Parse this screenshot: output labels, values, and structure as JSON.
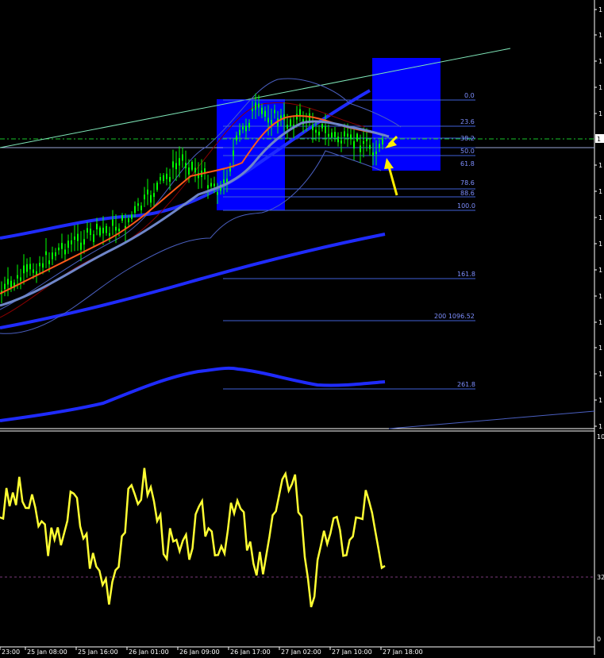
{
  "colors": {
    "background": "#000000",
    "candle": "#00ff00",
    "zone": "#0000ff",
    "ema_fast": "#ff5a1a",
    "ema_slow": "#6f86c9",
    "ma_thick": "#1f2bff",
    "bollinger": "#4a5fc0",
    "bollinger_red": "#8b0000",
    "channel": "#7fe6b8",
    "fib": "#3f5fd6",
    "fib_text": "#7e8fff",
    "dashed_level": "#19c42a",
    "oscillator": "#ffff33",
    "arrow": "#ffee00",
    "grid_text": "#ffffff"
  },
  "fibonacci": {
    "levels": [
      {
        "label": "0.0"
      },
      {
        "label": "23.6"
      },
      {
        "label": "38.2"
      },
      {
        "label": "50.0"
      },
      {
        "label": "61.8"
      },
      {
        "label": "78.6"
      },
      {
        "label": "88.6"
      },
      {
        "label": "100.0"
      },
      {
        "label": "161.8"
      },
      {
        "label": "200 1096.52"
      },
      {
        "label": "261.8"
      }
    ]
  },
  "price_badge": "1",
  "price_axis_ticks": [
    "1",
    "1",
    "1",
    "1",
    "1",
    "1",
    "1",
    "1",
    "1",
    "1",
    "1",
    "1",
    "1",
    "1",
    "1",
    "1",
    "1",
    "1",
    "1",
    "1",
    "1",
    "1"
  ],
  "oscillator_axis": {
    "top": "10",
    "mid": "32",
    "bottom": "0"
  },
  "time_axis": [
    "23:00",
    "25 Jan 08:00",
    "25 Jan 16:00",
    "26 Jan 01:00",
    "26 Jan 09:00",
    "26 Jan 17:00",
    "27 Jan 02:00",
    "27 Jan 10:00",
    "27 Jan 18:00"
  ],
  "chart_data": {
    "type": "line",
    "title": "",
    "price_trend": [
      1,
      2,
      3,
      4,
      5,
      6,
      7,
      8,
      7,
      6
    ],
    "oscillator_series": [
      {
        "name": "",
        "values": [
          62,
          72,
          58,
          40,
          70,
          34,
          18,
          65,
          80,
          45,
          35,
          58,
          42,
          66,
          22,
          60,
          88,
          12,
          55,
          40,
          70,
          20
        ]
      }
    ],
    "oscillator_range": [
      0,
      100
    ],
    "oscillator_level": 32,
    "grid": false
  }
}
